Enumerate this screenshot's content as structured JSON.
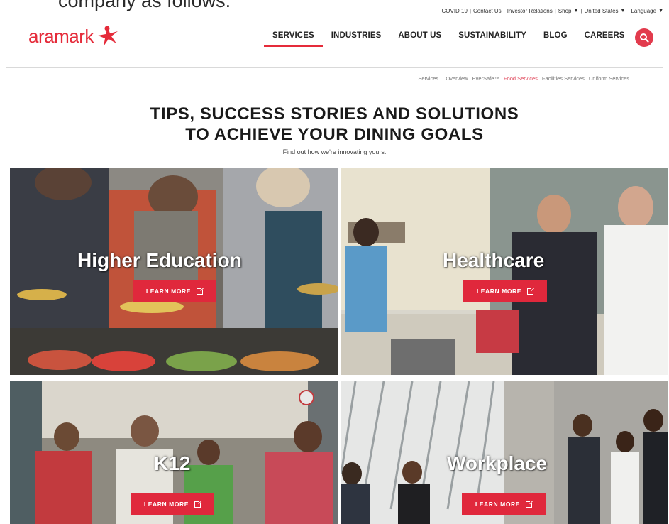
{
  "document_fragment": "company as follows:",
  "utility_bar": {
    "items": [
      "COVID 19",
      "Contact Us",
      "Investor Relations",
      "Shop",
      "United States",
      "Language"
    ]
  },
  "logo": {
    "text": "aramark"
  },
  "nav": {
    "items": [
      "SERVICES",
      "INDUSTRIES",
      "ABOUT US",
      "SUSTAINABILITY",
      "BLOG",
      "CAREERS"
    ],
    "active": "SERVICES"
  },
  "subnav": {
    "items": [
      "Services .",
      "Overview",
      "EverSafe™",
      "Food Services",
      "Facilities Services",
      "Uniform Services"
    ],
    "active": "Food Services"
  },
  "hero": {
    "title_line1": "TIPS, SUCCESS STORIES AND SOLUTIONS",
    "title_line2": "TO ACHIEVE YOUR DINING GOALS",
    "subtitle": "Find out how we're innovating yours."
  },
  "tiles": [
    {
      "label": "Higher Education",
      "button": "LEARN MORE"
    },
    {
      "label": "Healthcare",
      "button": "LEARN MORE"
    },
    {
      "label": "K12",
      "button": "LEARN MORE"
    },
    {
      "label": "Workplace",
      "button": "LEARN MORE"
    }
  ],
  "colors": {
    "brand_red": "#e52b3a",
    "button_red": "#e0283c",
    "search_red": "#e23b4d"
  },
  "icons": {
    "search": "search-icon",
    "external": "external-link-icon",
    "dropdown": "caret-down-icon"
  }
}
